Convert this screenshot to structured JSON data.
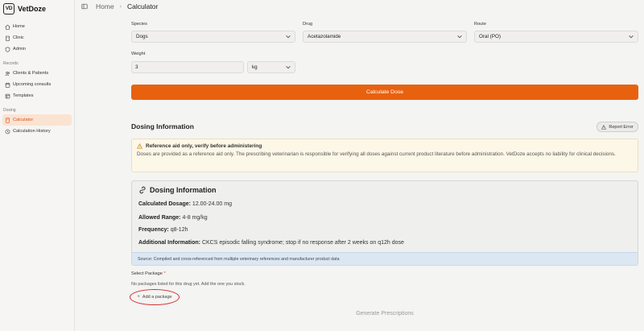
{
  "brand": {
    "logo": "VD",
    "name": "VetDoze"
  },
  "sidebar": {
    "items": [
      {
        "label": "Home",
        "icon": "home-icon"
      },
      {
        "label": "Clinic",
        "icon": "building-icon"
      },
      {
        "label": "Admin",
        "icon": "shield-icon"
      }
    ],
    "records_heading": "Records",
    "records_items": [
      {
        "label": "Clients & Patients",
        "icon": "users-icon"
      },
      {
        "label": "Upcoming consults",
        "icon": "calendar-icon"
      },
      {
        "label": "Templates",
        "icon": "template-icon"
      }
    ],
    "dosing_heading": "Dosing",
    "dosing_items": [
      {
        "label": "Calculator",
        "icon": "calculator-icon",
        "active": true
      },
      {
        "label": "Calculation History",
        "icon": "history-icon"
      }
    ]
  },
  "header": {
    "crumb_home": "Home",
    "separator": "›",
    "crumb_current": "Calculator"
  },
  "form": {
    "species_label": "Species",
    "species_value": "Dogs",
    "drug_label": "Drug",
    "drug_value": "Acetazolamide",
    "route_label": "Route",
    "route_value": "Oral (PO)",
    "weight_label": "Weight",
    "weight_value": "3",
    "unit_value": "kg",
    "calculate_label": "Calculate Dose"
  },
  "dosing": {
    "title": "Dosing Information",
    "report_label": "Report Error",
    "warning_title": "Reference aid only, verify before administering",
    "warning_body": "Doses are provided as a reference aid only. The prescribing veterinarian is responsible for verifying all doses against current product literature before administration. VetDoze accepts no liability for clinical decisions.",
    "card_title": "Dosing Information",
    "calculated_label": "Calculated Dosage:",
    "calculated_value": "12.00-24.00 mg",
    "range_label": "Allowed Range:",
    "range_value": "4-8 mg/kg",
    "frequency_label": "Frequency:",
    "frequency_value": "q8-12h",
    "additional_label": "Additional Information:",
    "additional_value": "CKCS episodic falling syndrome; stop if no response after 2 weeks on q12h dose",
    "source": "Source: Compiled and cross-referenced from multiple veterinary references and manufacturer product data"
  },
  "package": {
    "label": "Select Package",
    "required_mark": "*",
    "note": "No packages listed for this drug yet. Add the one you stock.",
    "add_label": "Add a package",
    "generate_label": "Generate Prescriptions"
  },
  "colors": {
    "accent": "#e8610f",
    "active_bg": "#fbe3d2",
    "highlight_circle": "#d22f2f"
  }
}
